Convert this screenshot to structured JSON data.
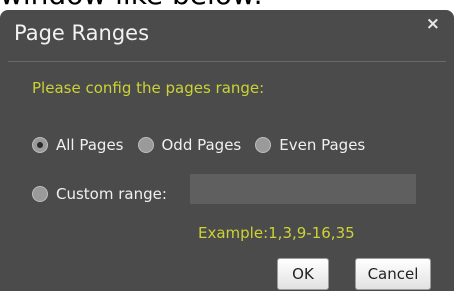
{
  "caption": "window like below:",
  "dialog": {
    "title": "Page Ranges",
    "close_glyph": "×",
    "prompt": "Please config the pages range:",
    "options": [
      {
        "label": "All Pages",
        "checked": true
      },
      {
        "label": "Odd Pages",
        "checked": false
      },
      {
        "label": "Even Pages",
        "checked": false
      }
    ],
    "custom": {
      "label": "Custom range:",
      "value": "",
      "checked": false
    },
    "example": "Example:1,3,9-16,35",
    "ok_label": "OK",
    "cancel_label": "Cancel"
  },
  "colors": {
    "dialog_bg": "#4b4b4b",
    "accent_text": "#cbd335",
    "input_bg": "#5f5f5f"
  },
  "icons": [
    "close-icon",
    "radio-icon"
  ]
}
